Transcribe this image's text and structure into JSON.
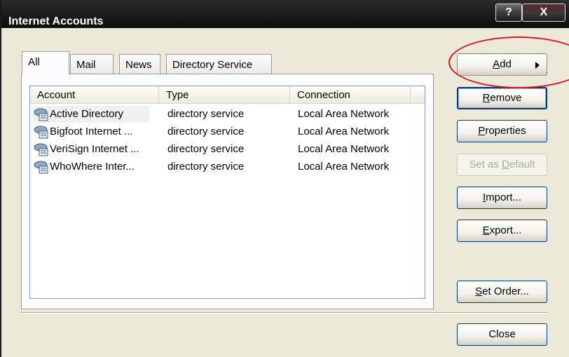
{
  "window": {
    "title": "Internet Accounts",
    "help_label": "?",
    "close_label": "X"
  },
  "tabs": [
    {
      "label": "All",
      "active": true
    },
    {
      "label": "Mail",
      "active": false
    },
    {
      "label": "News",
      "active": false
    },
    {
      "label": "Directory Service",
      "active": false
    }
  ],
  "list": {
    "columns": [
      "Account",
      "Type",
      "Connection"
    ],
    "rows": [
      {
        "account": "Active Directory",
        "type": "directory service",
        "connection": "Local Area Network"
      },
      {
        "account": "Bigfoot Internet ...",
        "type": "directory service",
        "connection": "Local Area Network"
      },
      {
        "account": "VeriSign Internet ...",
        "type": "directory service",
        "connection": "Local Area Network"
      },
      {
        "account": "WhoWhere Inter...",
        "type": "directory service",
        "connection": "Local Area Network"
      }
    ],
    "row_icon": "directory-service-icon"
  },
  "buttons": {
    "add": {
      "first": "A",
      "rest": "dd"
    },
    "remove": {
      "first": "R",
      "rest": "emove"
    },
    "properties": {
      "first": "P",
      "rest": "roperties"
    },
    "set_default": {
      "pre": "Set as ",
      "first": "D",
      "rest": "efault",
      "disabled": true
    },
    "import": {
      "first": "I",
      "rest": "mport..."
    },
    "export": {
      "first": "E",
      "rest": "xport..."
    },
    "set_order": {
      "first": "S",
      "rest": "et Order..."
    },
    "close": "Close"
  },
  "colors": {
    "annotation_circle": "#e3111b",
    "titlebar": "#1e1e1e",
    "dialog_bg": "#ece9d8"
  }
}
